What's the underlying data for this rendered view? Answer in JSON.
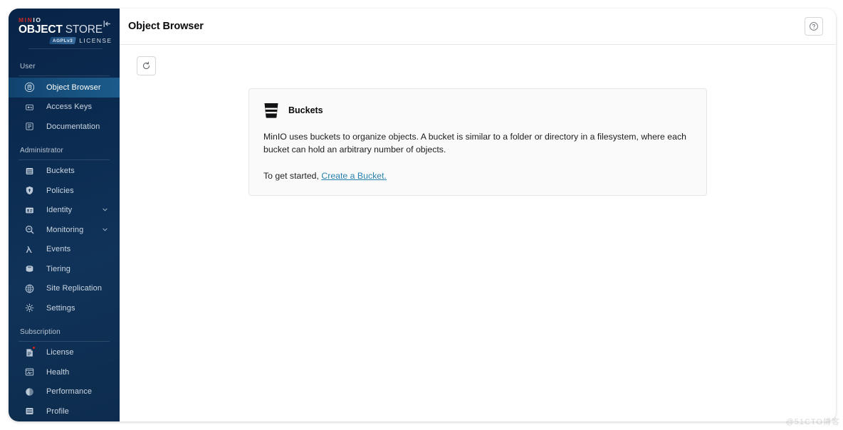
{
  "brand": {
    "minio": "MIN",
    "minio_io": "IO",
    "object": "OBJECT ",
    "store": "STORE",
    "agpl": "AGPLv3",
    "license": "LICENSE",
    "collapse_icon": "collapse-left-icon"
  },
  "sidebar": {
    "sections": [
      {
        "label": "User",
        "items": [
          {
            "label": "Object Browser",
            "icon": "object-browser-icon",
            "active": true
          },
          {
            "label": "Access Keys",
            "icon": "access-keys-icon",
            "active": false
          },
          {
            "label": "Documentation",
            "icon": "documentation-icon",
            "active": false
          }
        ]
      },
      {
        "label": "Administrator",
        "items": [
          {
            "label": "Buckets",
            "icon": "buckets-icon",
            "active": false
          },
          {
            "label": "Policies",
            "icon": "policies-shield-icon",
            "active": false
          },
          {
            "label": "Identity",
            "icon": "identity-icon",
            "active": false,
            "chevron": true
          },
          {
            "label": "Monitoring",
            "icon": "monitoring-magnifier-icon",
            "active": false,
            "chevron": true
          },
          {
            "label": "Events",
            "icon": "events-lambda-icon",
            "active": false
          },
          {
            "label": "Tiering",
            "icon": "tiering-icon",
            "active": false
          },
          {
            "label": "Site Replication",
            "icon": "site-replication-icon",
            "active": false
          },
          {
            "label": "Settings",
            "icon": "settings-gear-icon",
            "active": false
          }
        ]
      },
      {
        "label": "Subscription",
        "items": [
          {
            "label": "License",
            "icon": "license-icon",
            "active": false,
            "badge": true
          },
          {
            "label": "Health",
            "icon": "health-icon",
            "active": false
          },
          {
            "label": "Performance",
            "icon": "performance-icon",
            "active": false
          },
          {
            "label": "Profile",
            "icon": "profile-icon",
            "active": false
          }
        ]
      }
    ]
  },
  "header": {
    "title": "Object Browser",
    "help_icon": "help-circle-icon"
  },
  "toolbar": {
    "refresh_icon": "refresh-icon"
  },
  "main": {
    "card": {
      "icon": "bucket-icon",
      "title": "Buckets",
      "description": "MinIO uses buckets to organize objects. A bucket is similar to a folder or directory in a filesystem, where each bucket can hold an arbitrary number of objects.",
      "cta_prefix": "To get started, ",
      "cta_link": "Create a Bucket."
    }
  },
  "watermark": "@51CTO博客",
  "colors": {
    "sidebar_top": "#082447",
    "sidebar_bottom": "#0d2c4d",
    "active_item": "#18527f",
    "link": "#2781b0",
    "badge_red": "#e02020",
    "card_bg": "#fafafa",
    "card_border": "#e4e6e8"
  }
}
